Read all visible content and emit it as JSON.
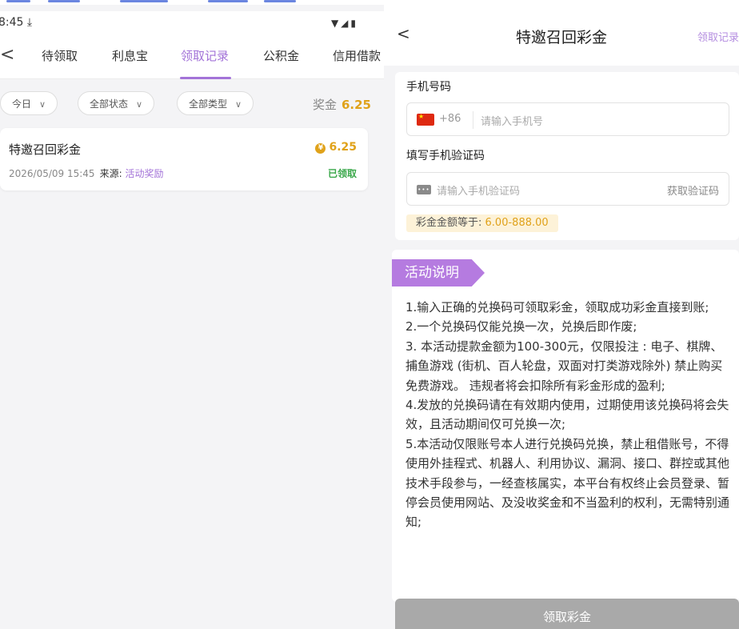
{
  "left": {
    "status": {
      "time": "8:45",
      "download_glyph": "⤓",
      "icons": "▼◢▮"
    },
    "tabs": {
      "back_glyph": "<",
      "items": [
        "待领取",
        "利息宝",
        "领取记录",
        "公积金",
        "信用借款"
      ],
      "active_index": 2
    },
    "filters": {
      "today": "今日",
      "status": "全部状态",
      "type": "全部类型",
      "bonus_label": "奖金",
      "bonus_value": "6.25"
    },
    "record": {
      "title": "特邀召回彩金",
      "amount": "6.25",
      "coin_glyph": "¥",
      "datetime": "2026/05/09 15:45",
      "source_label": "来源:",
      "source_value": "活动奖励",
      "status": "已领取"
    }
  },
  "right": {
    "header": {
      "back_glyph": "<",
      "title": "特邀召回彩金",
      "link": "领取记录"
    },
    "form": {
      "phone_label": "手机号码",
      "country_code": "+86",
      "phone_placeholder": "请输入手机号",
      "code_label": "填写手机验证码",
      "code_placeholder": "请输入手机验证码",
      "get_code": "获取验证码",
      "range_label": "彩金金额等于:",
      "range_value": "6.00-888.00"
    },
    "info": {
      "banner": "活动说明",
      "rules": [
        "1.输入正确的兑换码可领取彩金，领取成功彩金直接到账;",
        "2.一个兑换码仅能兑换一次，兑换后即作废;",
        "3. 本活动提款金额为100-300元，仅限投注 : 电子、棋牌、捕鱼游戏 (街机、百人轮盘，双面对打类游戏除外) 禁止购买免费游戏。 违规者将会扣除所有彩金形成的盈利;",
        "4.发放的兑换码请在有效期内使用，过期使用该兑换码将会失效，且活动期间仅可兑换一次;",
        "5.本活动仅限账号本人进行兑换码兑换，禁止租借账号，不得使用外挂程式、机器人、利用协议、漏洞、接口、群控或其他技术手段参与，一经查核属实，本平台有权终止会员登录、暂停会员使用网站、及没收奖金和不当盈利的权利，无需特别通知;"
      ]
    },
    "submit_label": "领取彩金"
  },
  "colors": {
    "accent": "#a373d8",
    "gold": "#e0a21a",
    "success": "#3aa84a",
    "banner": "#b57be0",
    "button_disabled": "#a9a9a9"
  }
}
